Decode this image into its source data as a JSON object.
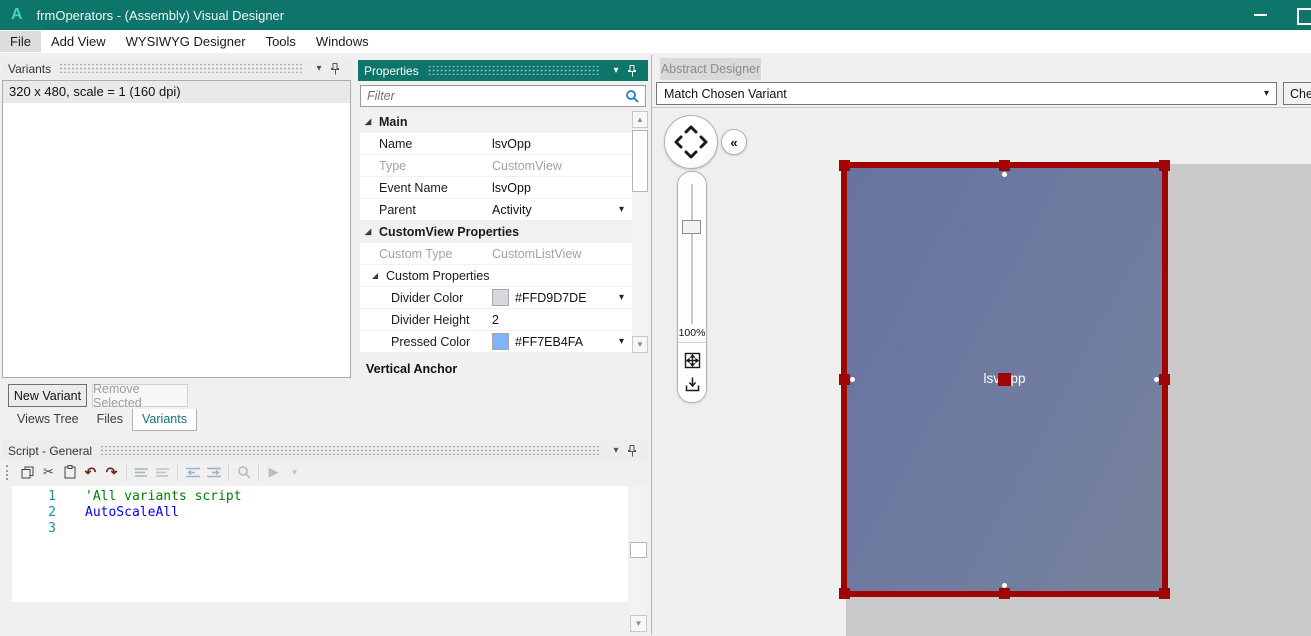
{
  "window": {
    "logo": "A",
    "title": "frmOperators - (Assembly) Visual Designer"
  },
  "menubar": {
    "items": [
      {
        "label": "File",
        "highlighted": true
      },
      {
        "label": "Add View",
        "highlighted": false
      },
      {
        "label": "WYSIWYG Designer",
        "highlighted": false
      },
      {
        "label": "Tools",
        "highlighted": false
      },
      {
        "label": "Windows",
        "highlighted": false
      }
    ]
  },
  "variants_panel": {
    "title": "Variants",
    "items": [
      "320 x 480, scale = 1 (160 dpi)"
    ],
    "new_variant_label": "New Variant",
    "remove_selected_label": "Remove Selected",
    "tabs": [
      {
        "label": "Views Tree",
        "active": false
      },
      {
        "label": "Files",
        "active": false
      },
      {
        "label": "Variants",
        "active": true
      }
    ]
  },
  "properties_panel": {
    "title": "Properties",
    "filter_placeholder": "Filter",
    "rows": [
      {
        "type": "section",
        "label": "Main"
      },
      {
        "type": "row",
        "label": "Name",
        "value": "lsvOpp"
      },
      {
        "type": "row",
        "label": "Type",
        "value": "CustomView",
        "readonly": true
      },
      {
        "type": "row",
        "label": "Event Name",
        "value": "lsvOpp"
      },
      {
        "type": "row",
        "label": "Parent",
        "value": "Activity",
        "dropdown": true
      },
      {
        "type": "section",
        "label": "CustomView Properties"
      },
      {
        "type": "row",
        "label": "Custom Type",
        "value": "CustomListView",
        "readonly": true
      },
      {
        "type": "group",
        "label": "Custom Properties"
      },
      {
        "type": "row",
        "label": "Divider Color",
        "value": "#FFD9D7DE",
        "swatch": "#D9D7DE",
        "dropdown": true,
        "indent": true
      },
      {
        "type": "row",
        "label": "Divider Height",
        "value": "2",
        "indent": true
      },
      {
        "type": "row",
        "label": "Pressed Color",
        "value": "#FF7EB4FA",
        "swatch": "#7EB4FA",
        "dropdown": true,
        "indent": true
      }
    ],
    "footer_label": "Vertical Anchor"
  },
  "script_panel": {
    "title": "Script - General",
    "lines": [
      {
        "number": "1",
        "text": "'All variants script",
        "kind": "comment"
      },
      {
        "number": "2",
        "text": "AutoScaleAll",
        "kind": "keyword"
      },
      {
        "number": "3",
        "text": "",
        "kind": "plain"
      }
    ]
  },
  "designer": {
    "tab_label": "Abstract Designer",
    "variant_combo_value": "Match Chosen Variant",
    "check_button_label": "Check",
    "zoom_level": "100%",
    "selected_view_label": "lsvOpp"
  },
  "colors": {
    "accent_teal": "#0E756B",
    "selection_red": "#A00505",
    "view_fill_start": "#68739F",
    "view_fill_end": "#76829B",
    "form_gray": "#C9C9C9",
    "canvas_gray": "#EFEFEF",
    "divider_color_swatch": "#D9D7DE",
    "pressed_color_swatch": "#7EB4FA",
    "code_comment": "#008000",
    "code_keyword": "#0000FF"
  }
}
